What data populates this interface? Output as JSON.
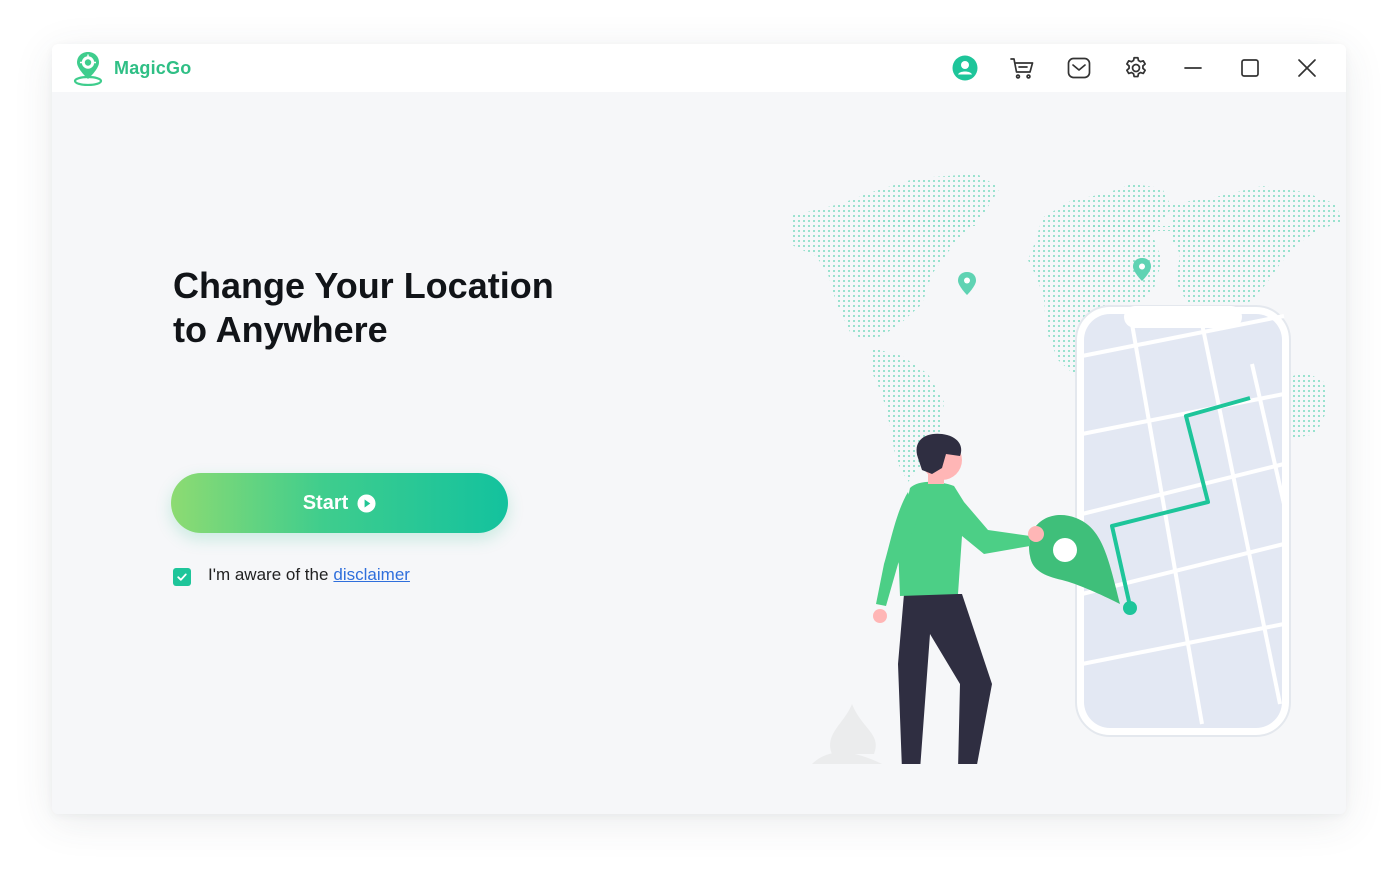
{
  "app": {
    "title": "MagicGo",
    "brand_color": "#2fbf85",
    "logo_icon": "location-pin-logo-icon"
  },
  "titlebar": {
    "buttons": [
      {
        "name": "account",
        "icon": "user-icon"
      },
      {
        "name": "cart",
        "icon": "cart-icon"
      },
      {
        "name": "messages",
        "icon": "mail-icon"
      },
      {
        "name": "settings",
        "icon": "gear-icon"
      },
      {
        "name": "minimize",
        "icon": "minimize-icon"
      },
      {
        "name": "maximize",
        "icon": "maximize-icon"
      },
      {
        "name": "close",
        "icon": "close-icon"
      }
    ]
  },
  "main": {
    "headline_line1": "Change Your Location",
    "headline_line2": "to Anywhere",
    "start_label": "Start",
    "start_icon": "play-circle-icon",
    "disclaimer": {
      "checked": true,
      "text": "I'm aware of the",
      "link_text": "disclaimer"
    }
  },
  "colors": {
    "accent": "#1ec59a",
    "gradient_start": "#8ddb72",
    "gradient_end": "#13c29e",
    "link": "#2f6fdc"
  }
}
